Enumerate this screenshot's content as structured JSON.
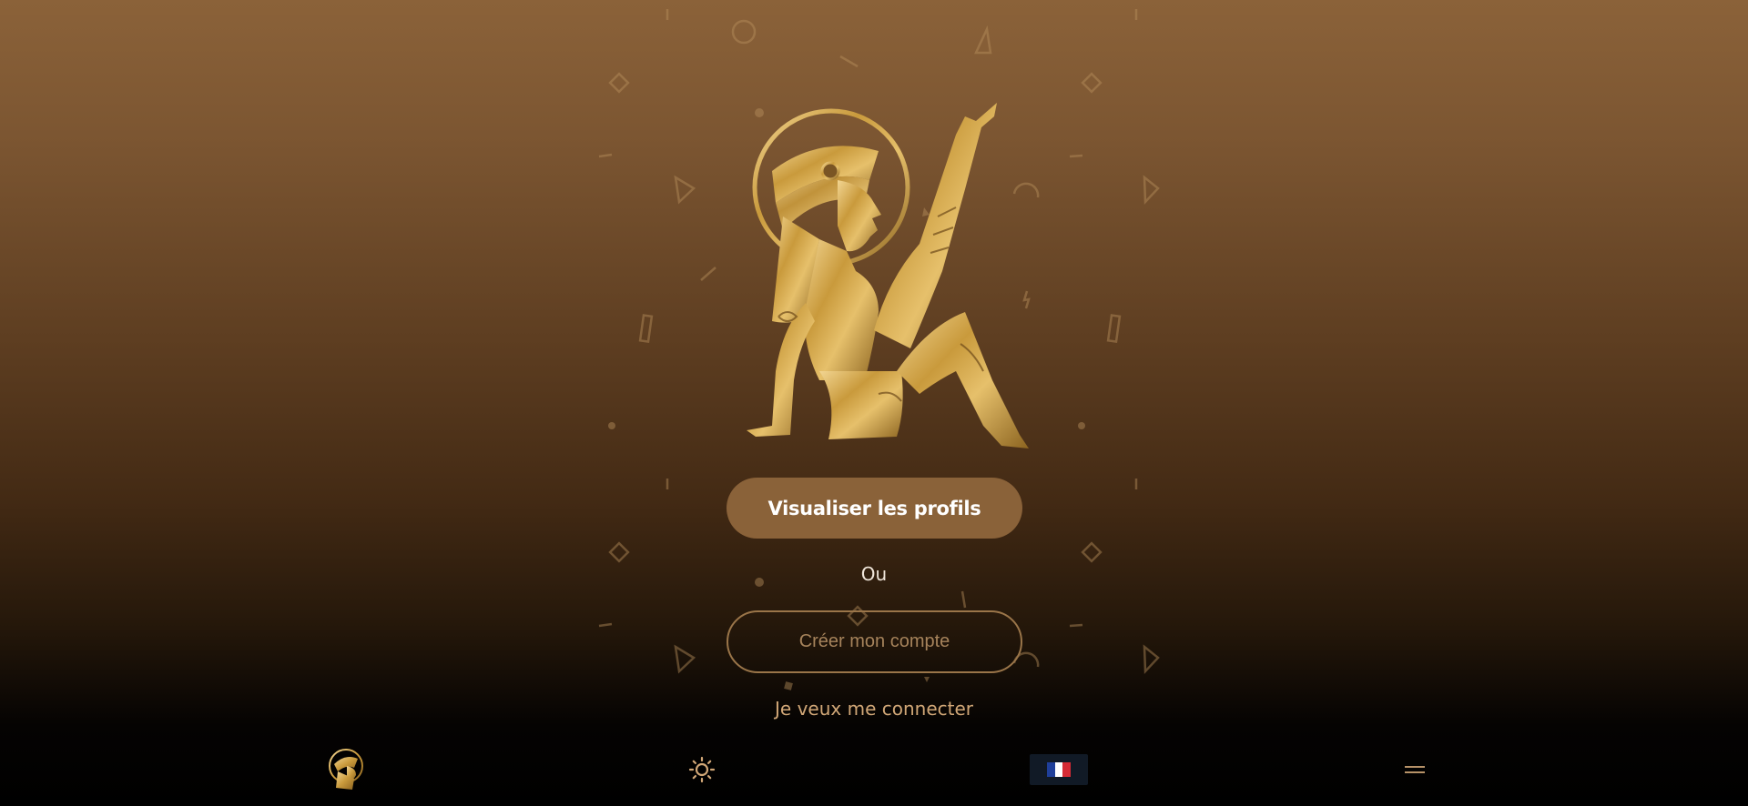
{
  "actions": {
    "view_profiles": "Visualiser les profils",
    "or": "Ou",
    "create_account": "Créer mon compte",
    "login": "Je veux me connecter"
  },
  "bottom_nav": {
    "items": [
      {
        "icon": "logo-icon"
      },
      {
        "icon": "sun-icon"
      },
      {
        "icon": "flag-fr-icon"
      },
      {
        "icon": "hamburger-menu-icon"
      }
    ]
  },
  "colors": {
    "primary_button": "#8a6239",
    "outline_button_border": "#9a7549",
    "login_link": "#d1a777",
    "gold": "#c9a04a",
    "flag_blue": "#1f3f9a",
    "flag_white": "#ffffff",
    "flag_red": "#d52b35"
  }
}
